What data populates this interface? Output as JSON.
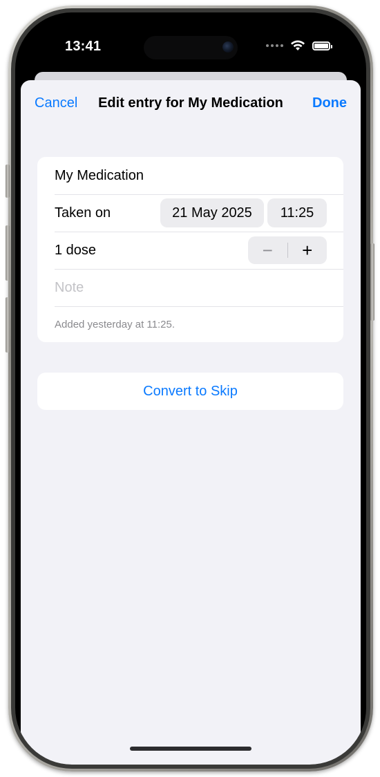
{
  "status_bar": {
    "time": "13:41",
    "icons": [
      "dots-icon",
      "wifi-icon",
      "battery-icon"
    ]
  },
  "nav": {
    "cancel_label": "Cancel",
    "title": "Edit entry for My Medication",
    "done_label": "Done"
  },
  "form": {
    "medication_name": "My Medication",
    "taken_on_label": "Taken on",
    "date_value": "21 May 2025",
    "time_value": "11:25",
    "dose_label": "1 dose",
    "stepper_minus": "−",
    "stepper_plus": "+",
    "note_placeholder": "Note",
    "footer_text": "Added yesterday at 11:25."
  },
  "actions": {
    "convert_label": "Convert to Skip"
  },
  "colors": {
    "accent": "#0a7aff",
    "background": "#f2f2f7"
  }
}
